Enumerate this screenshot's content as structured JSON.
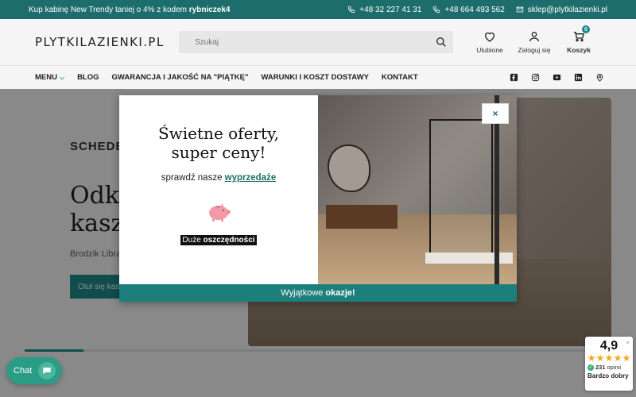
{
  "topbar": {
    "promo_prefix": "Kup kabinę New Trendy taniej o 4% z kodem ",
    "promo_code": "rybniczek4",
    "phone1": "+48 32 227 41 31",
    "phone2": "+48 664 493 562",
    "email": "sklep@plytkilazienki.pl"
  },
  "header": {
    "logo": "PLYTKILAZIENKI.PL",
    "search_placeholder": "Szukaj",
    "favorites": "Ulubione",
    "login": "Zaloguj się",
    "cart": "Koszyk",
    "cart_count": "0"
  },
  "nav": {
    "items": [
      "MENU",
      "BLOG",
      "GWARANCJA I JAKOŚĆ NA \"PIĄTKĘ\"",
      "WARUNKI I KOSZT DOSTAWY",
      "KONTAKT"
    ],
    "social_icons": [
      "facebook-icon",
      "instagram-icon",
      "youtube-icon",
      "linkedin-icon",
      "location-icon"
    ]
  },
  "hero": {
    "brand": "SCHEDE",
    "title_line1": "Odkr",
    "title_line2": "kasz",
    "subtitle": "Brodzik Libra",
    "button": "Otul się kasz",
    "progress": 0.1
  },
  "popup": {
    "title_line1": "Świetne oferty,",
    "title_line2": "super ceny!",
    "sub_prefix": "sprawdź nasze ",
    "sub_link": "wyprzedaże",
    "savings_prefix": "Duże ",
    "savings_bold": "oszczędności",
    "close": "×",
    "bottom_prefix": "Wyjątkowe ",
    "bottom_bold": "okazje!"
  },
  "chat": {
    "label": "Chat"
  },
  "rating": {
    "score": "4,9",
    "stars": 5,
    "count": "231",
    "count_suffix": "opinii",
    "label": "Bardzo dobry",
    "close": "×"
  },
  "colors": {
    "brand": "#1d6d6c",
    "accent": "#1d8f8c",
    "star": "#f5a623"
  }
}
